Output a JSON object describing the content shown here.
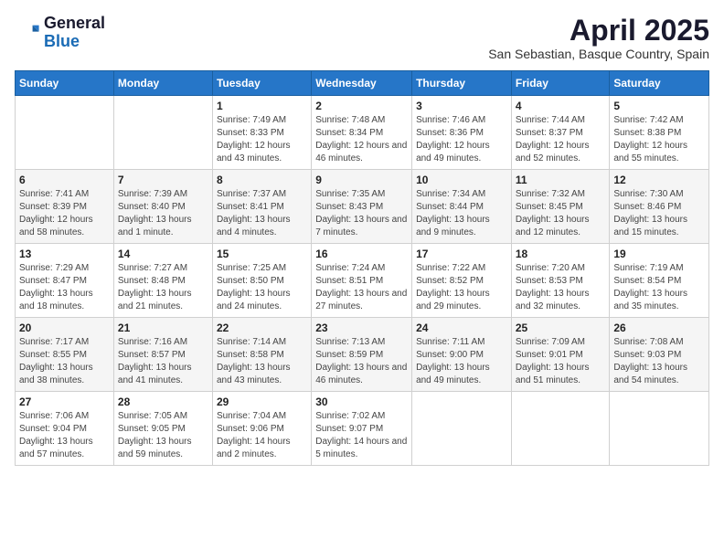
{
  "header": {
    "logo_general": "General",
    "logo_blue": "Blue",
    "month_title": "April 2025",
    "location": "San Sebastian, Basque Country, Spain"
  },
  "days_of_week": [
    "Sunday",
    "Monday",
    "Tuesday",
    "Wednesday",
    "Thursday",
    "Friday",
    "Saturday"
  ],
  "weeks": [
    [
      {
        "day": "",
        "info": ""
      },
      {
        "day": "",
        "info": ""
      },
      {
        "day": "1",
        "info": "Sunrise: 7:49 AM\nSunset: 8:33 PM\nDaylight: 12 hours and 43 minutes."
      },
      {
        "day": "2",
        "info": "Sunrise: 7:48 AM\nSunset: 8:34 PM\nDaylight: 12 hours and 46 minutes."
      },
      {
        "day": "3",
        "info": "Sunrise: 7:46 AM\nSunset: 8:36 PM\nDaylight: 12 hours and 49 minutes."
      },
      {
        "day": "4",
        "info": "Sunrise: 7:44 AM\nSunset: 8:37 PM\nDaylight: 12 hours and 52 minutes."
      },
      {
        "day": "5",
        "info": "Sunrise: 7:42 AM\nSunset: 8:38 PM\nDaylight: 12 hours and 55 minutes."
      }
    ],
    [
      {
        "day": "6",
        "info": "Sunrise: 7:41 AM\nSunset: 8:39 PM\nDaylight: 12 hours and 58 minutes."
      },
      {
        "day": "7",
        "info": "Sunrise: 7:39 AM\nSunset: 8:40 PM\nDaylight: 13 hours and 1 minute."
      },
      {
        "day": "8",
        "info": "Sunrise: 7:37 AM\nSunset: 8:41 PM\nDaylight: 13 hours and 4 minutes."
      },
      {
        "day": "9",
        "info": "Sunrise: 7:35 AM\nSunset: 8:43 PM\nDaylight: 13 hours and 7 minutes."
      },
      {
        "day": "10",
        "info": "Sunrise: 7:34 AM\nSunset: 8:44 PM\nDaylight: 13 hours and 9 minutes."
      },
      {
        "day": "11",
        "info": "Sunrise: 7:32 AM\nSunset: 8:45 PM\nDaylight: 13 hours and 12 minutes."
      },
      {
        "day": "12",
        "info": "Sunrise: 7:30 AM\nSunset: 8:46 PM\nDaylight: 13 hours and 15 minutes."
      }
    ],
    [
      {
        "day": "13",
        "info": "Sunrise: 7:29 AM\nSunset: 8:47 PM\nDaylight: 13 hours and 18 minutes."
      },
      {
        "day": "14",
        "info": "Sunrise: 7:27 AM\nSunset: 8:48 PM\nDaylight: 13 hours and 21 minutes."
      },
      {
        "day": "15",
        "info": "Sunrise: 7:25 AM\nSunset: 8:50 PM\nDaylight: 13 hours and 24 minutes."
      },
      {
        "day": "16",
        "info": "Sunrise: 7:24 AM\nSunset: 8:51 PM\nDaylight: 13 hours and 27 minutes."
      },
      {
        "day": "17",
        "info": "Sunrise: 7:22 AM\nSunset: 8:52 PM\nDaylight: 13 hours and 29 minutes."
      },
      {
        "day": "18",
        "info": "Sunrise: 7:20 AM\nSunset: 8:53 PM\nDaylight: 13 hours and 32 minutes."
      },
      {
        "day": "19",
        "info": "Sunrise: 7:19 AM\nSunset: 8:54 PM\nDaylight: 13 hours and 35 minutes."
      }
    ],
    [
      {
        "day": "20",
        "info": "Sunrise: 7:17 AM\nSunset: 8:55 PM\nDaylight: 13 hours and 38 minutes."
      },
      {
        "day": "21",
        "info": "Sunrise: 7:16 AM\nSunset: 8:57 PM\nDaylight: 13 hours and 41 minutes."
      },
      {
        "day": "22",
        "info": "Sunrise: 7:14 AM\nSunset: 8:58 PM\nDaylight: 13 hours and 43 minutes."
      },
      {
        "day": "23",
        "info": "Sunrise: 7:13 AM\nSunset: 8:59 PM\nDaylight: 13 hours and 46 minutes."
      },
      {
        "day": "24",
        "info": "Sunrise: 7:11 AM\nSunset: 9:00 PM\nDaylight: 13 hours and 49 minutes."
      },
      {
        "day": "25",
        "info": "Sunrise: 7:09 AM\nSunset: 9:01 PM\nDaylight: 13 hours and 51 minutes."
      },
      {
        "day": "26",
        "info": "Sunrise: 7:08 AM\nSunset: 9:03 PM\nDaylight: 13 hours and 54 minutes."
      }
    ],
    [
      {
        "day": "27",
        "info": "Sunrise: 7:06 AM\nSunset: 9:04 PM\nDaylight: 13 hours and 57 minutes."
      },
      {
        "day": "28",
        "info": "Sunrise: 7:05 AM\nSunset: 9:05 PM\nDaylight: 13 hours and 59 minutes."
      },
      {
        "day": "29",
        "info": "Sunrise: 7:04 AM\nSunset: 9:06 PM\nDaylight: 14 hours and 2 minutes."
      },
      {
        "day": "30",
        "info": "Sunrise: 7:02 AM\nSunset: 9:07 PM\nDaylight: 14 hours and 5 minutes."
      },
      {
        "day": "",
        "info": ""
      },
      {
        "day": "",
        "info": ""
      },
      {
        "day": "",
        "info": ""
      }
    ]
  ]
}
